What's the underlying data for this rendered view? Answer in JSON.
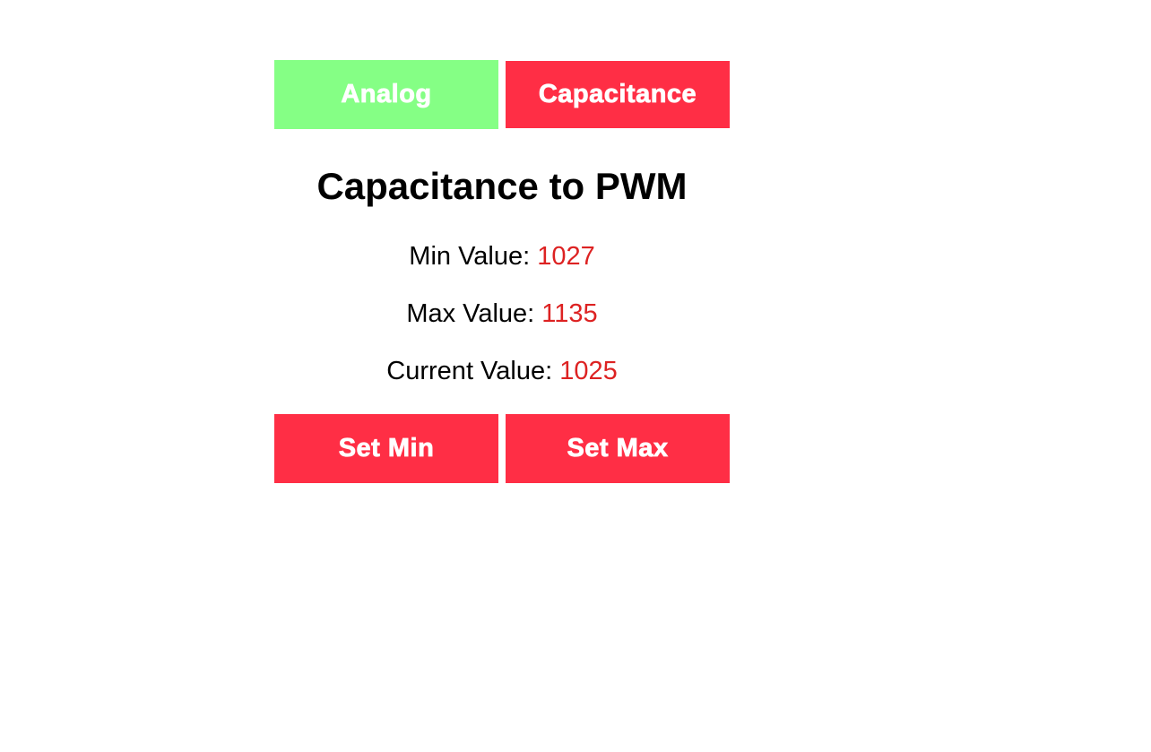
{
  "tabs": {
    "analog": {
      "label": "Analog",
      "color": "#85ff85"
    },
    "capacitance": {
      "label": "Capacitance",
      "color": "#ff2e45"
    }
  },
  "page_title": "Capacitance to PWM",
  "values": {
    "min": {
      "label": "Min Value: ",
      "value": "1027"
    },
    "max": {
      "label": "Max Value: ",
      "value": "1135"
    },
    "current": {
      "label": "Current Value: ",
      "value": "1025"
    }
  },
  "value_color": "#dd2222",
  "actions": {
    "set_min": {
      "label": "Set Min",
      "color": "#ff2e45"
    },
    "set_max": {
      "label": "Set Max",
      "color": "#ff2e45"
    }
  }
}
